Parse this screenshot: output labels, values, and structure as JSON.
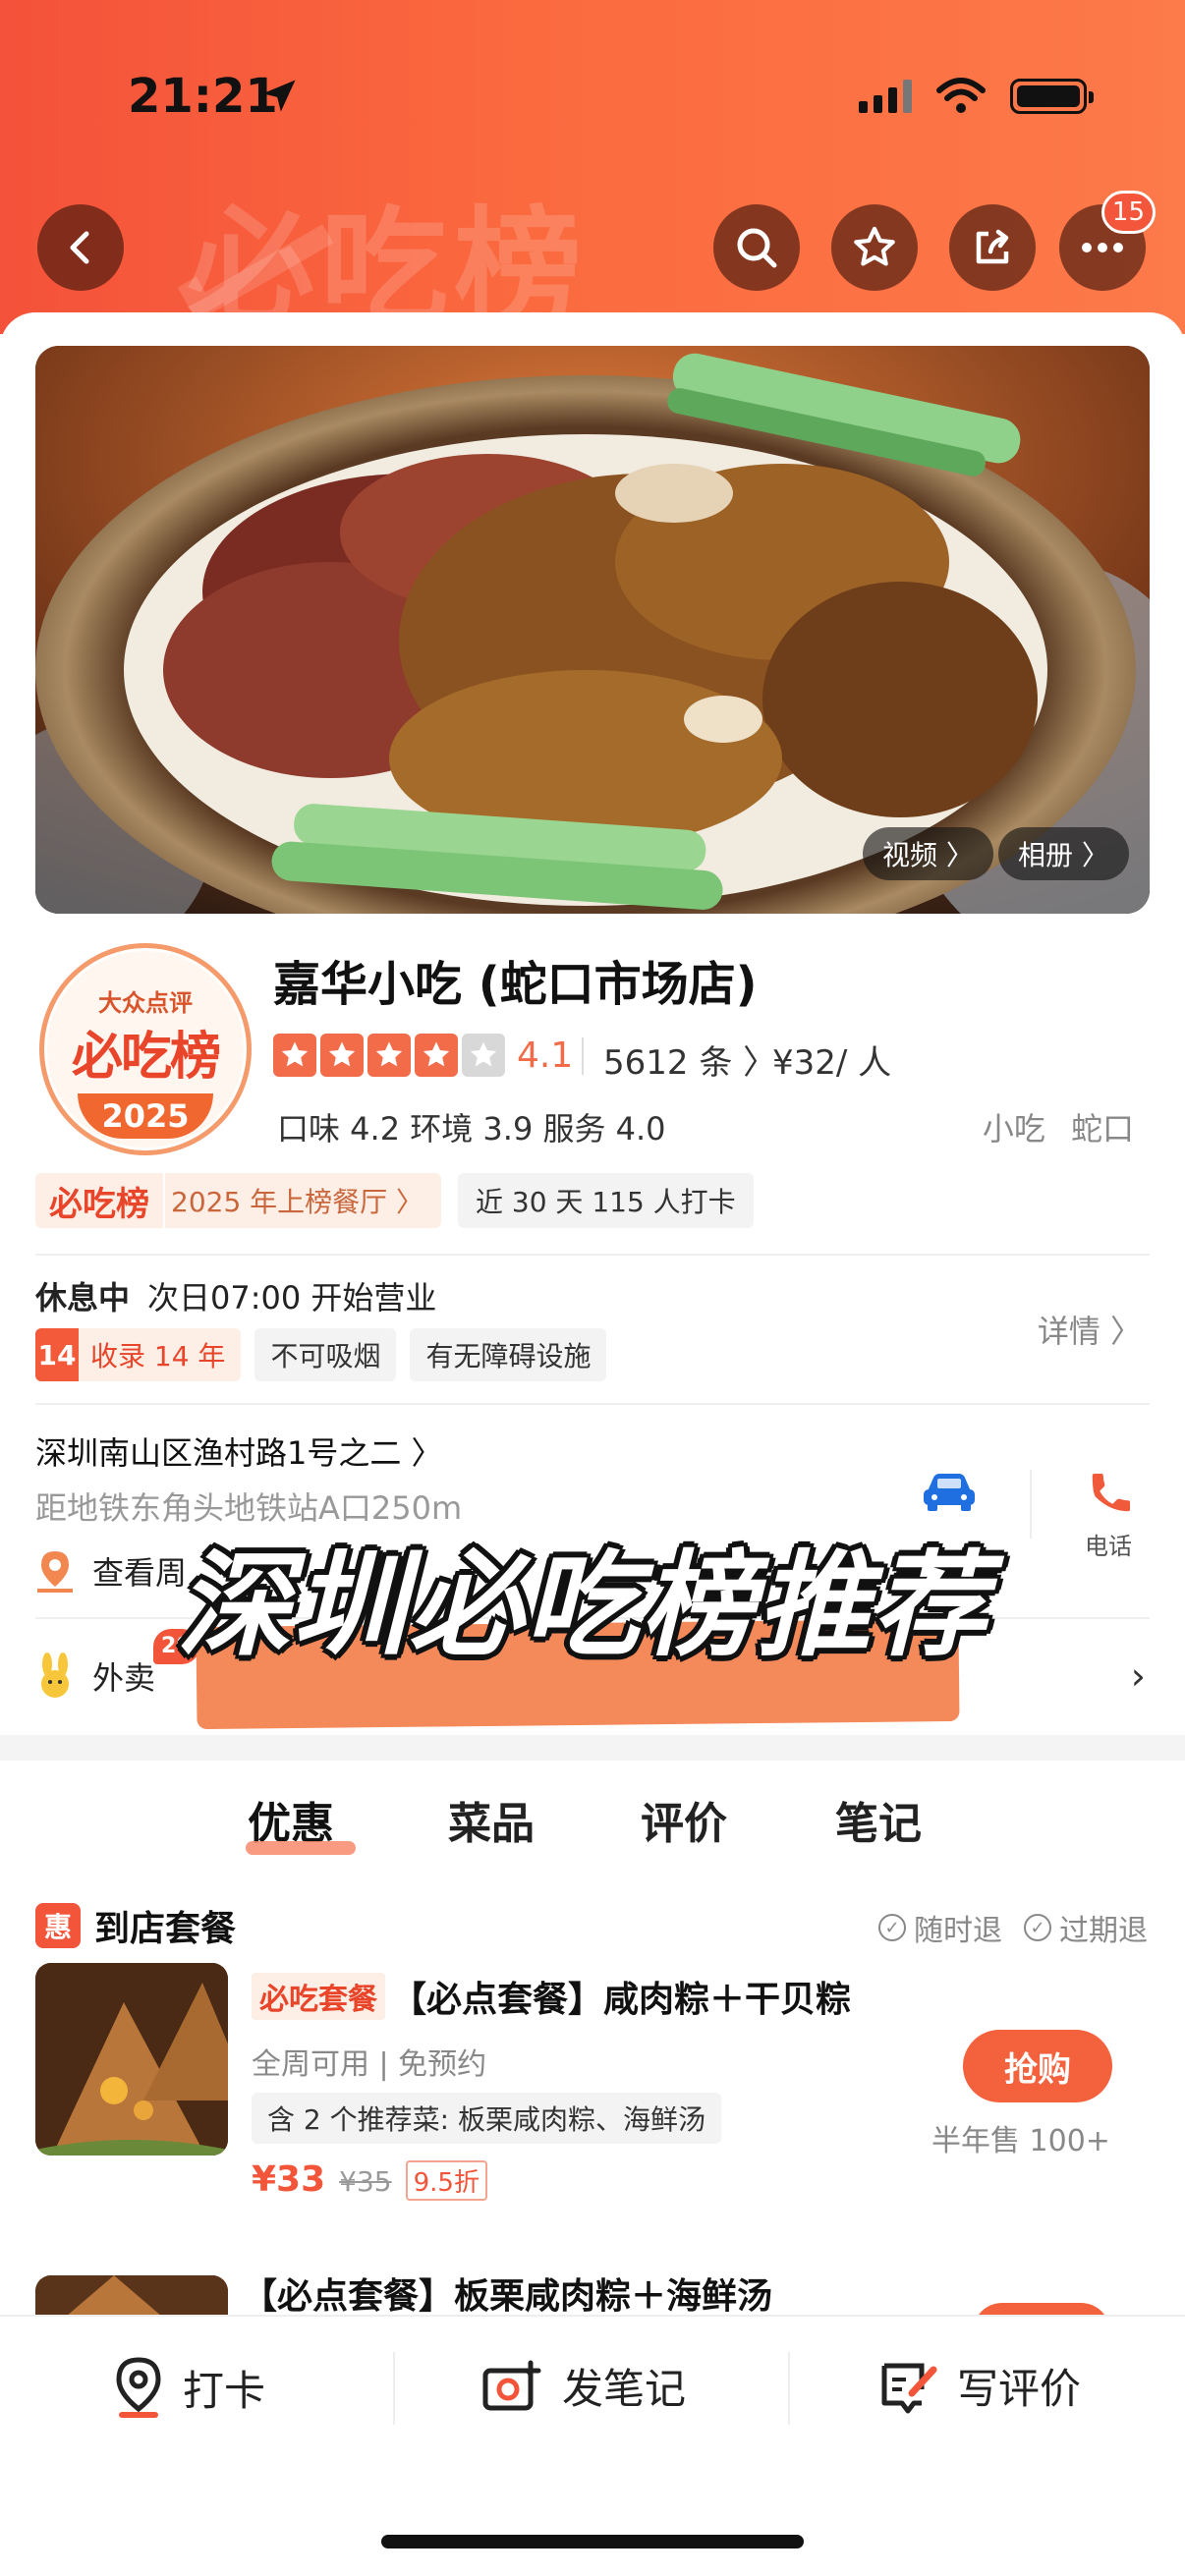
{
  "status_bar": {
    "time": "21:21"
  },
  "header": {
    "watermark": "必吃榜",
    "badge_count": "15",
    "colors": {
      "bg_start": "#f4523a",
      "bg_end": "#fd7a4a"
    }
  },
  "hero": {
    "video_label": "视频 〉",
    "album_label": "相册 〉"
  },
  "seal": {
    "top": "大众点评",
    "mid": "必吃榜",
    "year": "2025"
  },
  "shop": {
    "name": "嘉华小吃 (蛇口市场店)",
    "rating": "4.1",
    "rating_value": 4.1,
    "reviews": "5612 条 〉",
    "price": "¥32/ 人",
    "scores": "口味 4.2  环境 3.9  服务 4.0",
    "category_area": "小吃  蛇口",
    "rank_logo": "必吃榜",
    "rank_text": "2025 年上榜餐厅 〉",
    "checkin": "近 30 天 115 人打卡"
  },
  "hours": {
    "status": "休息中",
    "next": "次日07:00 开始营业",
    "detail": "详情 〉",
    "years_num": "14",
    "years_text": "收录 14 年",
    "no_smoke": "不可吸烟",
    "accessible": "有无障碍设施"
  },
  "location": {
    "address": "深圳南山区渔村路1号之二 〉",
    "metro": "距地铁东角头地铁站A口250m",
    "phone_label": "电话",
    "nearby": "查看周"
  },
  "waimai": {
    "label": "外卖",
    "badge": "20"
  },
  "overlay_caption": "深圳必吃榜推荐",
  "tabs": [
    "优惠",
    "菜品",
    "评价",
    "笔记"
  ],
  "deals": {
    "section_title": "到店套餐",
    "hui": "惠",
    "flag_refund": "随时退",
    "flag_expire": "过期退",
    "item1": {
      "logo": "必吃套餐",
      "title": "【必点套餐】咸肉粽＋干贝粽",
      "sub": "全周可用 | 免预约",
      "includes": "含 2 个推荐菜: 板栗咸肉粽、海鲜汤",
      "price_now": "¥33",
      "price_old": "¥35",
      "discount": "9.5折",
      "buy": "抢购",
      "sold": "半年售 100+"
    },
    "item2": {
      "title": "【必点套餐】板栗咸肉粽＋海鲜汤"
    }
  },
  "bottom_bar": {
    "checkin": "打卡",
    "note": "发笔记",
    "review": "写评价"
  }
}
